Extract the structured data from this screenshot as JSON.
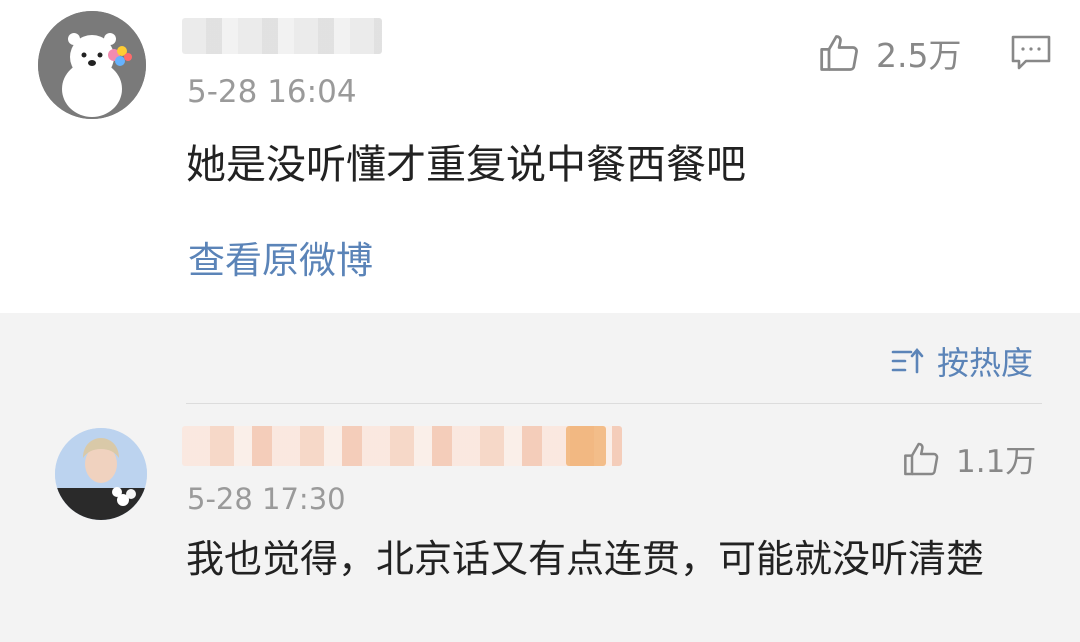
{
  "post": {
    "time": "5-28 16:04",
    "text": "她是没听懂才重复说中餐西餐吧",
    "likes": "2.5万",
    "view_original": "查看原微博"
  },
  "sort": {
    "label": "按热度"
  },
  "reply": {
    "time": "5-28 17:30",
    "text": "我也觉得，北京话又有点连贯，可能就没听清楚",
    "likes": "1.1万"
  }
}
